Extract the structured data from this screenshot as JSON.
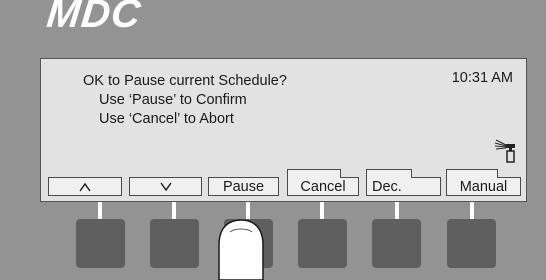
{
  "device": {
    "brand": "MDC"
  },
  "display": {
    "message_lines": [
      "OK to Pause current Schedule?",
      "Use  ‘Pause’ to Confirm",
      "Use  ‘Cancel’ to Abort"
    ],
    "time": "10:31 AM",
    "status_icon": "sprinkler-icon"
  },
  "softkeys": [
    {
      "label": "^",
      "icon": "arrow-up"
    },
    {
      "label": "v",
      "icon": "arrow-down"
    },
    {
      "label": "Pause"
    },
    {
      "label": "Cancel"
    },
    {
      "label": "Dec."
    },
    {
      "label": "Manual"
    }
  ],
  "colors": {
    "body": "#939393",
    "screen": "#e2e2e2",
    "hardware_button": "#5f5f5f",
    "brand": "#ffffff"
  }
}
